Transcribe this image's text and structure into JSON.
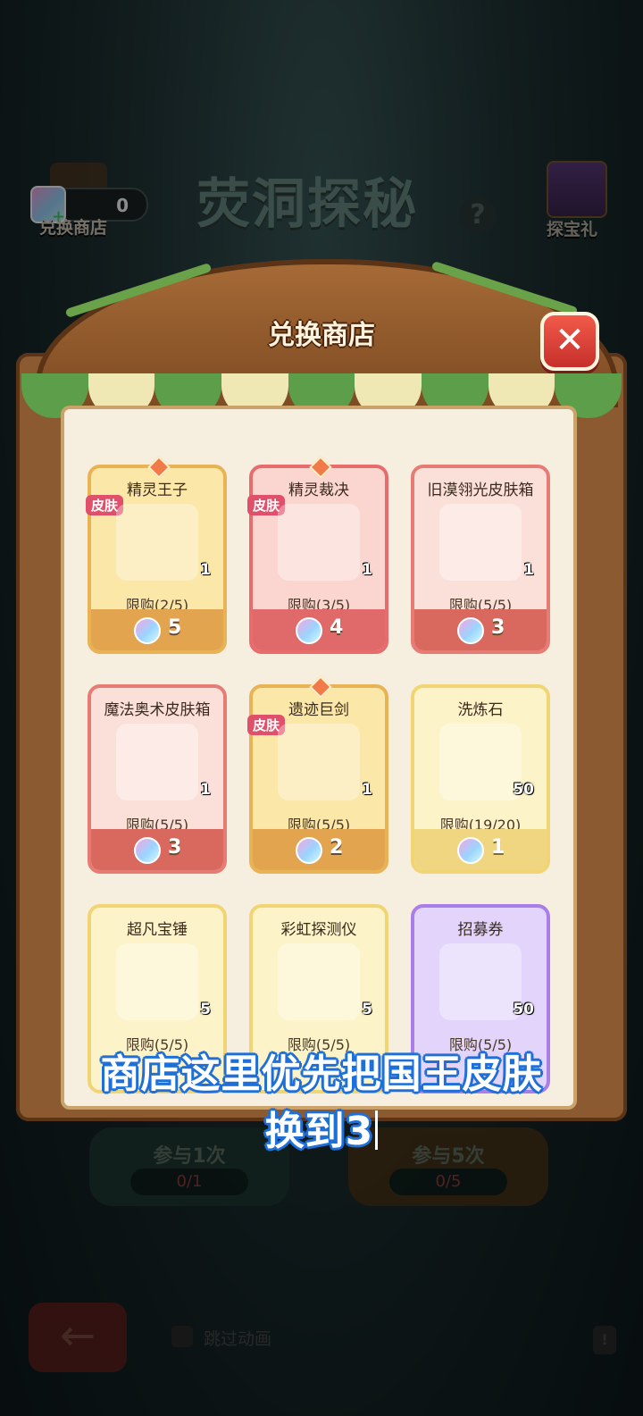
{
  "hud": {
    "currency_value": "0",
    "shop_label": "兑换商店",
    "event_title": "荧洞探秘",
    "help_glyph": "?",
    "gift_label": "探宝礼"
  },
  "modal": {
    "title": "兑换商店",
    "close_glyph": "✕",
    "skin_tag_label": "皮肤",
    "items": [
      {
        "name": "精灵王子",
        "qty": "1",
        "limit": "限购(2/5)",
        "price": "5",
        "icon": "prince-skin"
      },
      {
        "name": "精灵裁决",
        "qty": "1",
        "limit": "限购(3/5)",
        "price": "4",
        "icon": "spear-skin"
      },
      {
        "name": "旧漠翎光皮肤箱",
        "qty": "1",
        "limit": "限购(5/5)",
        "price": "3",
        "icon": "skin-chest"
      },
      {
        "name": "魔法奥术皮肤箱",
        "qty": "1",
        "limit": "限购(5/5)",
        "price": "3",
        "icon": "magic-chest"
      },
      {
        "name": "遗迹巨剑",
        "qty": "1",
        "limit": "限购(5/5)",
        "price": "2",
        "icon": "greatsword-skin"
      },
      {
        "name": "洗炼石",
        "qty": "50",
        "limit": "限购(19/20)",
        "price": "1",
        "icon": "refine-stone"
      },
      {
        "name": "超凡宝锤",
        "qty": "5",
        "limit": "限购(5/5)",
        "price": "",
        "icon": "hammer"
      },
      {
        "name": "彩虹探测仪",
        "qty": "5",
        "limit": "限购(5/5)",
        "price": "",
        "icon": "detector"
      },
      {
        "name": "招募券",
        "qty": "50",
        "limit": "限购(5/5)",
        "price": "",
        "icon": "recruit-ticket"
      }
    ]
  },
  "bottom": {
    "join_1_label": "参与1次",
    "join_1_count": "0/1",
    "join_5_label": "参与5次",
    "join_5_count": "0/5",
    "back_glyph": "←",
    "skip_label": "跳过动画",
    "alert_glyph": "!"
  },
  "subtitle": {
    "line1": "商店这里优先把国王皮肤",
    "line2": "换到3"
  }
}
